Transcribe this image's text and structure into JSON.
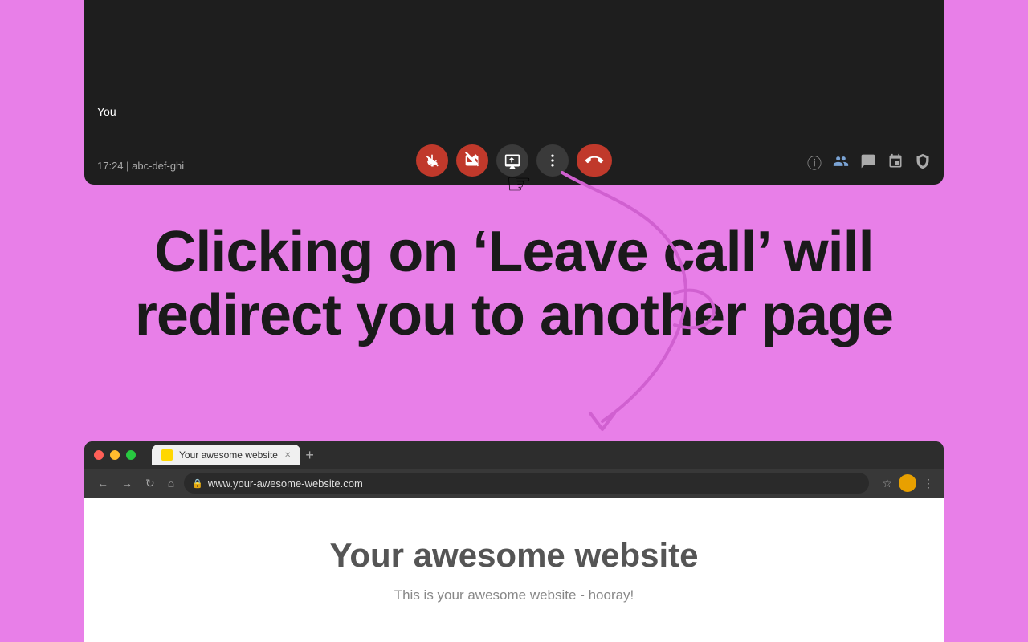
{
  "background_color": "#e87fe8",
  "video_bar": {
    "you_label": "You",
    "call_info": "17:24 | abc-def-ghi"
  },
  "controls": {
    "mic_label": "mute-microphone",
    "camera_label": "turn-off-camera",
    "present_label": "present-screen",
    "more_label": "more-options",
    "leave_label": "leave-call"
  },
  "right_icons": [
    "info",
    "people",
    "chat",
    "activities",
    "safety"
  ],
  "main_text": "Clicking on ‘Leave call’ will redirect you to another page",
  "browser": {
    "tab_label": "Your awesome website",
    "address": "www.your-awesome-website.com",
    "website_title": "Your awesome website",
    "website_subtitle": "This is your awesome website - hooray!"
  }
}
